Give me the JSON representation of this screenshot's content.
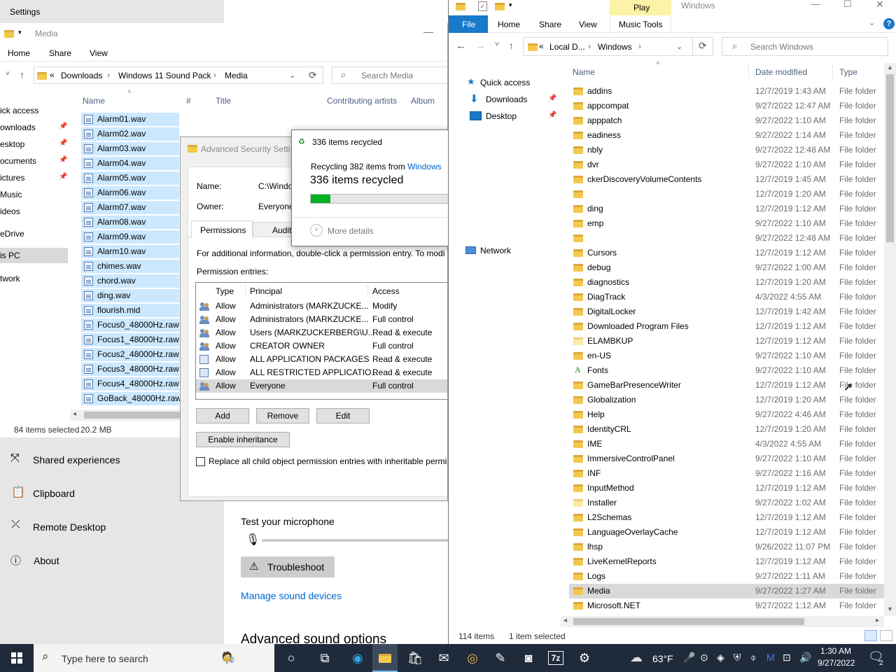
{
  "settings": {
    "title": "Settings",
    "nav": [
      "Shared experiences",
      "Clipboard",
      "Remote Desktop",
      "About"
    ],
    "mic_heading": "Test your microphone",
    "troubleshoot": "Troubleshoot",
    "manage_link": "Manage sound devices",
    "advanced_heading": "Advanced sound options"
  },
  "media_explorer": {
    "title": "Media",
    "ribbon_tabs": [
      "Home",
      "Share",
      "View"
    ],
    "path": [
      "Downloads",
      "Windows 11 Sound Pack",
      "Media"
    ],
    "path_prefix": "«",
    "search_placeholder": "Search Media",
    "columns": [
      "Name",
      "#",
      "Title",
      "Contributing artists",
      "Album"
    ],
    "nav": [
      "ick access",
      "ownloads",
      "esktop",
      "ocuments",
      "ictures",
      "Music",
      "ideos",
      "eDrive",
      "is PC",
      "twork"
    ],
    "files": [
      "Alarm01.wav",
      "Alarm02.wav",
      "Alarm03.wav",
      "Alarm04.wav",
      "Alarm05.wav",
      "Alarm06.wav",
      "Alarm07.wav",
      "Alarm08.wav",
      "Alarm09.wav",
      "Alarm10.wav",
      "chimes.wav",
      "chord.wav",
      "ding.wav",
      "flourish.mid",
      "Focus0_48000Hz.raw",
      "Focus1_48000Hz.raw",
      "Focus2_48000Hz.raw",
      "Focus3_48000Hz.raw",
      "Focus4_48000Hz.raw",
      "GoBack_48000Hz.raw"
    ],
    "status_count": "84 items selected",
    "status_size": "20.2 MB"
  },
  "security": {
    "title": "Advanced Security Setti",
    "name_label": "Name:",
    "name_value": "C:\\Windo",
    "owner_label": "Owner:",
    "owner_value": "Everyone",
    "tabs": [
      "Permissions",
      "Audit"
    ],
    "info": "For additional information, double-click a permission entry. To modi",
    "entries_label": "Permission entries:",
    "headers": [
      "Type",
      "Principal",
      "Access"
    ],
    "entries": [
      {
        "type": "Allow",
        "principal": "Administrators (MARKZUCKE...",
        "access": "Modify",
        "icon": "user-group"
      },
      {
        "type": "Allow",
        "principal": "Administrators (MARKZUCKE...",
        "access": "Full control",
        "icon": "user-group"
      },
      {
        "type": "Allow",
        "principal": "Users (MARKZUCKERBERG\\U...",
        "access": "Read & execute",
        "icon": "user-group"
      },
      {
        "type": "Allow",
        "principal": "CREATOR OWNER",
        "access": "Full control",
        "icon": "user-group"
      },
      {
        "type": "Allow",
        "principal": "ALL APPLICATION PACKAGES",
        "access": "Read & execute",
        "icon": "package"
      },
      {
        "type": "Allow",
        "principal": "ALL RESTRICTED APPLICATIO...",
        "access": "Read & execute",
        "icon": "package"
      },
      {
        "type": "Allow",
        "principal": "Everyone",
        "access": "Full control",
        "icon": "user-group"
      }
    ],
    "add": "Add",
    "remove": "Remove",
    "edit": "Edit",
    "enable_inheritance": "Enable inheritance",
    "replace_label": "Replace all child object permission entries with inheritable permis"
  },
  "recycle": {
    "title": "336 items recycled",
    "desc_prefix": "Recycling 382 items from",
    "desc_link": "Windows",
    "status": "336 items recycled",
    "progress": 0.07,
    "more": "More details"
  },
  "windows_explorer": {
    "title": "Windows",
    "context_tab": "Play",
    "ribbon_tabs": [
      "File",
      "Home",
      "Share",
      "View",
      "Music Tools"
    ],
    "path": [
      "Local D...",
      "Windows"
    ],
    "path_prefix": "«",
    "search_placeholder": "Search Windows",
    "nav": [
      "Quick access",
      "Downloads",
      "Desktop",
      "Network"
    ],
    "columns": [
      "Name",
      "Date modified",
      "Type"
    ],
    "rows": [
      [
        "addins",
        "12/7/2019 1:43 AM",
        "File folder"
      ],
      [
        "appcompat",
        "9/27/2022 12:47 AM",
        "File folder"
      ],
      [
        "apppatch",
        "9/27/2022 1:10 AM",
        "File folder"
      ],
      [
        "eadiness",
        "9/27/2022 1:14 AM",
        "File folder"
      ],
      [
        "nbly",
        "9/27/2022 12:48 AM",
        "File folder"
      ],
      [
        "dvr",
        "9/27/2022 1:10 AM",
        "File folder"
      ],
      [
        "ckerDiscoveryVolumeContents",
        "12/7/2019 1:45 AM",
        "File folder"
      ],
      [
        "",
        "12/7/2019 1:20 AM",
        "File folder"
      ],
      [
        "ding",
        "12/7/2019 1:12 AM",
        "File folder"
      ],
      [
        "emp",
        "9/27/2022 1:10 AM",
        "File folder"
      ],
      [
        "",
        "9/27/2022 12:48 AM",
        "File folder"
      ],
      [
        "Cursors",
        "12/7/2019 1:12 AM",
        "File folder"
      ],
      [
        "debug",
        "9/27/2022 1:00 AM",
        "File folder"
      ],
      [
        "diagnostics",
        "12/7/2019 1:20 AM",
        "File folder"
      ],
      [
        "DiagTrack",
        "4/3/2022 4:55 AM",
        "File folder"
      ],
      [
        "DigitalLocker",
        "12/7/2019 1:42 AM",
        "File folder"
      ],
      [
        "Downloaded Program Files",
        "12/7/2019 1:12 AM",
        "File folder"
      ],
      [
        "ELAMBKUP",
        "12/7/2019 1:12 AM",
        "File folder"
      ],
      [
        "en-US",
        "9/27/2022 1:10 AM",
        "File folder"
      ],
      [
        "Fonts",
        "9/27/2022 1:10 AM",
        "File folder"
      ],
      [
        "GameBarPresenceWriter",
        "12/7/2019 1:12 AM",
        "File folder"
      ],
      [
        "Globalization",
        "12/7/2019 1:20 AM",
        "File folder"
      ],
      [
        "Help",
        "9/27/2022 4:46 AM",
        "File folder"
      ],
      [
        "IdentityCRL",
        "12/7/2019 1:20 AM",
        "File folder"
      ],
      [
        "IME",
        "4/3/2022 4:55 AM",
        "File folder"
      ],
      [
        "ImmersiveControlPanel",
        "9/27/2022 1:10 AM",
        "File folder"
      ],
      [
        "INF",
        "9/27/2022 1:16 AM",
        "File folder"
      ],
      [
        "InputMethod",
        "12/7/2019 1:12 AM",
        "File folder"
      ],
      [
        "Installer",
        "9/27/2022 1:02 AM",
        "File folder"
      ],
      [
        "L2Schemas",
        "12/7/2019 1:12 AM",
        "File folder"
      ],
      [
        "LanguageOverlayCache",
        "12/7/2019 1:12 AM",
        "File folder"
      ],
      [
        "lhsp",
        "9/26/2022 11:07 PM",
        "File folder"
      ],
      [
        "LiveKernelReports",
        "12/7/2019 1:12 AM",
        "File folder"
      ],
      [
        "Logs",
        "9/27/2022 1:11 AM",
        "File folder"
      ],
      [
        "Media",
        "9/27/2022 1:27 AM",
        "File folder"
      ],
      [
        "Microsoft.NET",
        "9/27/2022 1:12 AM",
        "File folder"
      ]
    ],
    "status_count": "114 items",
    "status_selected": "1 item selected"
  },
  "taskbar": {
    "search_placeholder": "Type here to search",
    "temperature": "63°F",
    "time": "1:30 AM",
    "date": "9/27/2022",
    "notification_count": "2"
  },
  "colors": {
    "accent": "#0078d7",
    "progress": "#06b025",
    "taskbar": "#1f2a3a",
    "selection": "#cce8ff",
    "link": "#0066cc"
  }
}
